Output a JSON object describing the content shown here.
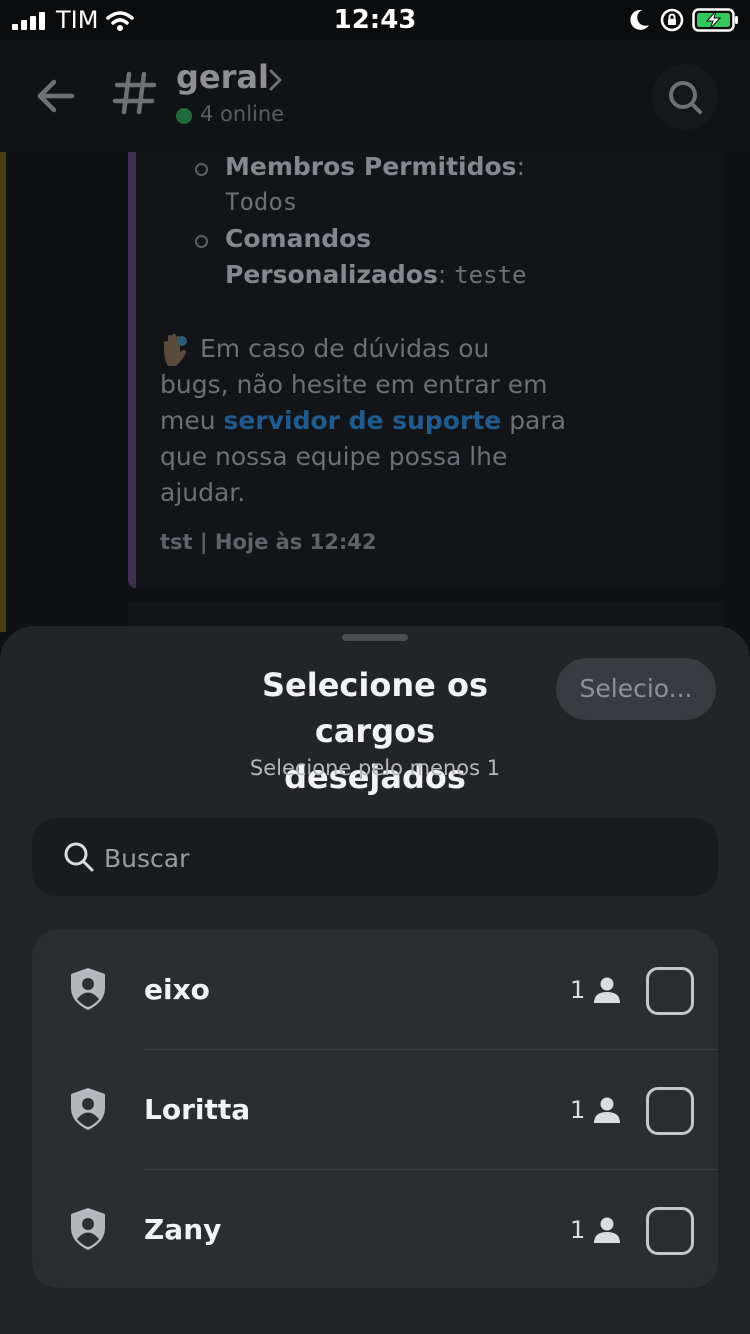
{
  "status_bar": {
    "carrier": "TIM",
    "time": "12:43"
  },
  "header": {
    "channel_name": "geral",
    "online_text": "4 online"
  },
  "chat": {
    "item1_label": "Membros Permitidos",
    "item1_colon": ":",
    "item1_value": "Todos",
    "item2_label_line1": "Comandos",
    "item2_label_line2": "Personalizados",
    "item2_colon": ":",
    "item2_value": "teste",
    "para_line1": "Em caso de dúvidas ou",
    "para_line2": "bugs, não hesite em entrar em",
    "para_line3_pre": "meu",
    "para_link": "servidor de suporte",
    "para_line3_post": "para",
    "para_line4": "que nossa equipe possa lhe",
    "para_line5": "ajudar.",
    "footer": "tst | Hoje às 12:42"
  },
  "sheet": {
    "title_line1": "Selecione os cargos",
    "title_line2": "desejados",
    "subtitle": "Selecione pelo menos 1",
    "select_button": "Selecio...",
    "search_placeholder": "Buscar",
    "roles": [
      {
        "name": "eixo",
        "count": "1",
        "checked": false
      },
      {
        "name": "Loritta",
        "count": "1",
        "checked": false
      },
      {
        "name": "Zany",
        "count": "1",
        "checked": false
      }
    ]
  },
  "colors": {
    "sheet_bg": "#232428",
    "list_bg": "#2b2d31",
    "online": "#23a55a",
    "link": "#00a8fc"
  }
}
